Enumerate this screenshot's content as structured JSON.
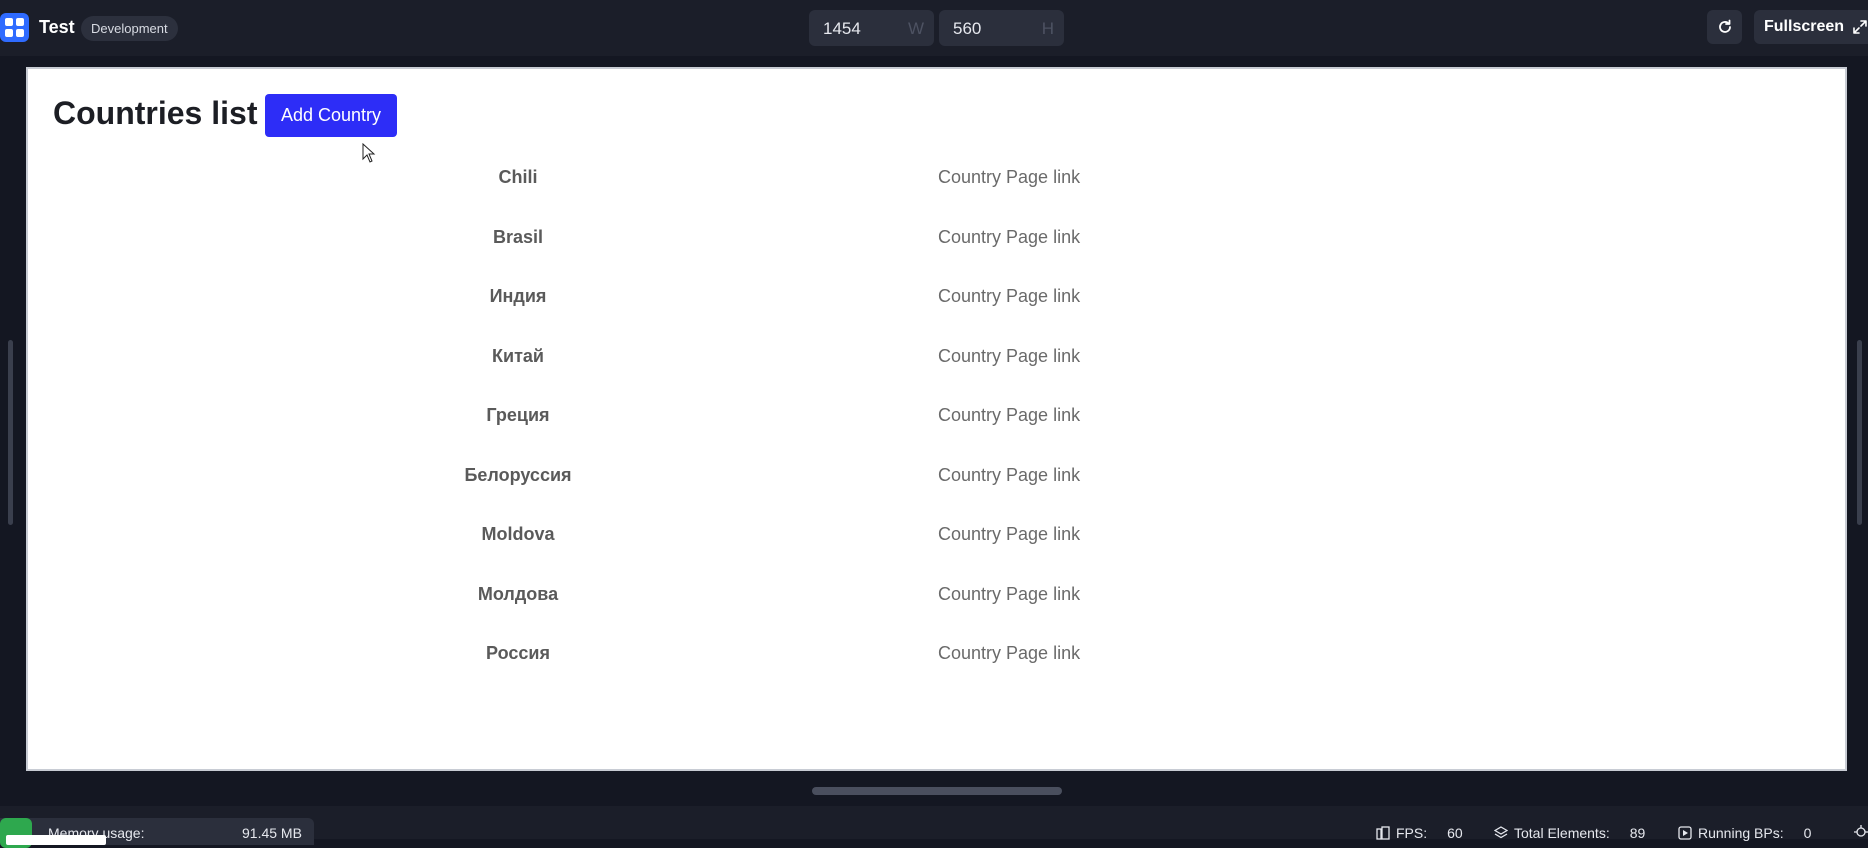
{
  "topbar": {
    "app_title": "Test",
    "env_badge": "Development",
    "width_value": "1454",
    "width_unit": "W",
    "height_value": "560",
    "height_unit": "H",
    "fullscreen_label": "Fullscreen"
  },
  "page": {
    "title": "Countries list",
    "add_button_label": "Add Country",
    "countries": [
      {
        "name": "Chili",
        "link": "Country Page link"
      },
      {
        "name": "Brasil",
        "link": "Country Page link"
      },
      {
        "name": "Индия",
        "link": "Country Page link"
      },
      {
        "name": "Китай",
        "link": "Country Page link"
      },
      {
        "name": "Греция",
        "link": "Country Page link"
      },
      {
        "name": "Белоруссия",
        "link": "Country Page link"
      },
      {
        "name": "Moldova",
        "link": "Country Page link"
      },
      {
        "name": "Молдова",
        "link": "Country Page link"
      },
      {
        "name": "Россия",
        "link": "Country Page link"
      }
    ]
  },
  "statusbar": {
    "memory_label": "Memory usage:",
    "memory_value": "91.45 MB",
    "fps_label": "FPS:",
    "fps_value": "60",
    "elements_label": "Total Elements:",
    "elements_value": "89",
    "bps_label": "Running BPs:",
    "bps_value": "0"
  },
  "colors": {
    "accent": "#2d2df7",
    "logo": "#2f6bff",
    "chrome_bg": "#1b1e29",
    "memory_icon": "#2ea84e"
  }
}
